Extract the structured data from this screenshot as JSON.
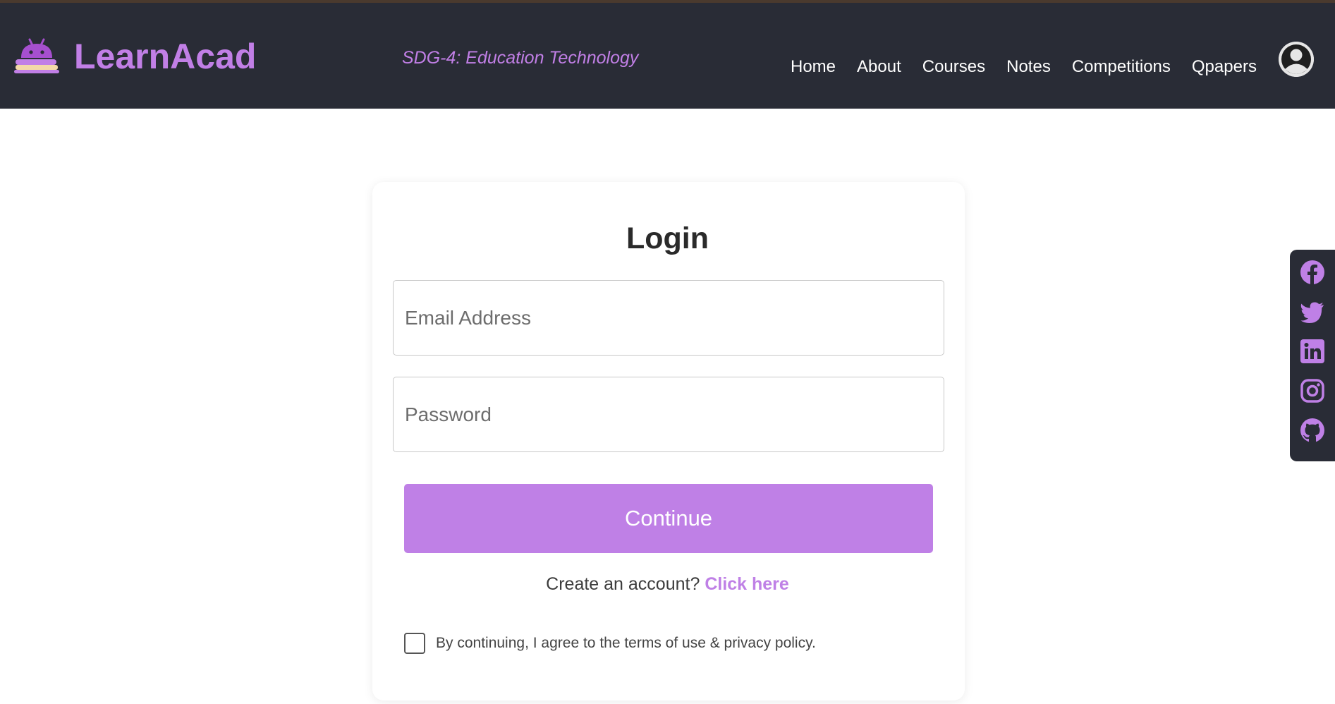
{
  "brand": {
    "name": "LearnAcad",
    "tagline": "SDG-4: Education Technology"
  },
  "nav": {
    "items": [
      {
        "label": "Home"
      },
      {
        "label": "About"
      },
      {
        "label": "Courses"
      },
      {
        "label": "Notes"
      },
      {
        "label": "Competitions"
      },
      {
        "label": "Qpapers"
      }
    ],
    "avatar_icon": "user-avatar-icon"
  },
  "login": {
    "title": "Login",
    "email_placeholder": "Email Address",
    "email_value": "",
    "password_placeholder": "Password",
    "password_value": "",
    "continue_label": "Continue",
    "signup_prompt": "Create an account?",
    "signup_link": "Click here",
    "agree_text": "By continuing, I agree to the terms of use & privacy policy.",
    "agree_checked": false
  },
  "social": {
    "icons": [
      "facebook-icon",
      "twitter-icon",
      "linkedin-icon",
      "instagram-icon",
      "github-icon"
    ]
  },
  "colors": {
    "accent": "#bf80e6",
    "navbar_bg": "#292c36"
  }
}
